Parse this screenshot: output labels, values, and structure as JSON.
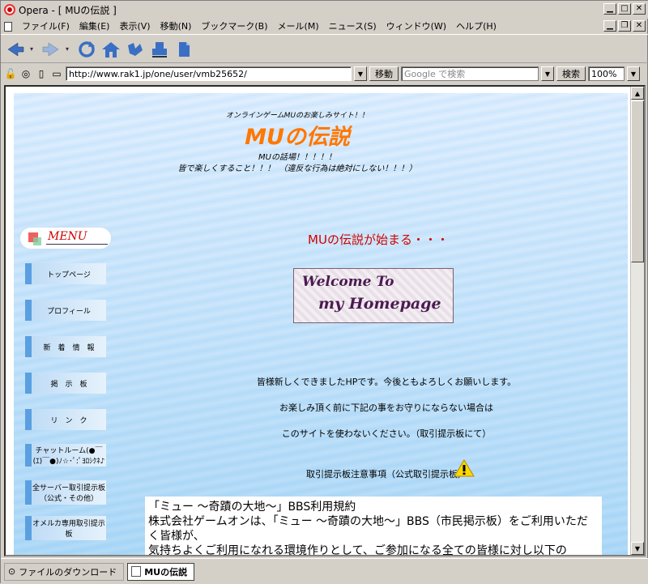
{
  "window": {
    "title": "Opera - [ MUの伝説 ]"
  },
  "menubar": {
    "items": [
      "ファイル(F)",
      "編集(E)",
      "表示(V)",
      "移動(N)",
      "ブックマーク(B)",
      "メール(M)",
      "ニュース(S)",
      "ウィンドウ(W)",
      "ヘルプ(H)"
    ]
  },
  "addressbar": {
    "url": "http://www.rak1.jp/one/user/vmb25652/",
    "go_label": "移動",
    "search_placeholder": "Google で検索",
    "search_label": "検索",
    "zoom": "100%"
  },
  "page": {
    "header_small": "オンラインゲームMUのお楽しみサイト！！",
    "site_title": "MUの伝説",
    "header_line1": "MUの話場！！！！！",
    "header_line2": "皆で楽しくすること！！！　（違反な行為は絶対にしない！！！）",
    "menu_banner": "MENU",
    "nav": [
      "トップページ",
      "プロフィール",
      "新　着　情　報",
      "掲　示　板",
      "リ　ン　ク",
      "チャットルーム(●￣(ｴ)￣●)ﾉ☆･ﾟ:ﾟﾖﾛｼｸﾈ♪",
      "全サーバー取引提示板（公式・その他）",
      "オメルカ専用取引提示板"
    ],
    "main_heading": "MUの伝説が始まる・・・",
    "welcome_line1": "Welcome To",
    "welcome_line2": "my Homepage",
    "body_line1": "皆様新しくできましたHPです。今後ともよろしくお願いします。",
    "body_line2": "お楽しみ頂く前に下記の事をお守りにならない場合は",
    "body_line3": "このサイトを使わないください。（取引提示板にて）",
    "body_line4": "取引提示板注意事項（公式取引提示板）",
    "rules_line1": "「ミュー ～奇蹟の大地～」BBS利用規約",
    "rules_line2": "株式会社ゲームオンは、「ミュー ～奇蹟の大地～」BBS（市民掲示板）をご利用いただく皆様が、",
    "rules_line3": "気持ちよくご利用になれる環境作りとして、ご参加になる全ての皆様に対し以下の"
  },
  "statusbar": {
    "download_label": "ファイルのダウンロード",
    "tab_label": "MUの伝説"
  },
  "colors": {
    "title_orange": "#ff7700",
    "heading_red": "#d00000",
    "nav_accent": "#5aa0e0"
  }
}
